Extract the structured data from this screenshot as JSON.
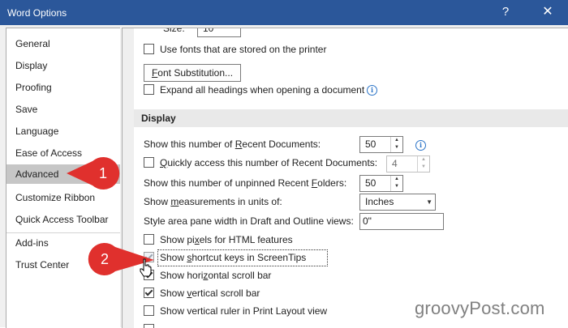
{
  "window": {
    "title": "Word Options",
    "help_label": "?",
    "close_label": "✕"
  },
  "nav": {
    "items": [
      {
        "label": "General"
      },
      {
        "label": "Display"
      },
      {
        "label": "Proofing"
      },
      {
        "label": "Save"
      },
      {
        "label": "Language"
      },
      {
        "label": "Ease of Access"
      },
      {
        "label": "Advanced",
        "selected": true
      },
      {
        "label": "Customize Ribbon"
      },
      {
        "label": "Quick Access Toolbar"
      },
      {
        "label": "Add-ins"
      },
      {
        "label": "Trust Center"
      }
    ]
  },
  "main": {
    "top": {
      "size_partial": "Size:",
      "size_value": "10",
      "use_printer_fonts": {
        "label": "Use fonts that are stored on the printer",
        "checked": false
      },
      "font_substitution_prefix": "F",
      "font_substitution_rest": "ont Substitution...",
      "expand_headings": {
        "label": "Expand all headings when opening a document",
        "checked": false
      }
    },
    "display": {
      "heading": "Display",
      "recent_docs_pre": "Show this number of ",
      "recent_docs_key": "R",
      "recent_docs_post": "ecent Documents:",
      "recent_docs_value": "50",
      "quick_access_key": "Q",
      "quick_access_post": "uickly access this number of Recent Documents:",
      "quick_access_value": "4",
      "quick_access_checked": false,
      "recent_folders_pre": "Show this number of unpinned Recent ",
      "recent_folders_key": "F",
      "recent_folders_post": "olders:",
      "recent_folders_value": "50",
      "measurement_pre": "Show ",
      "measurement_key": "m",
      "measurement_post": "easurements in units of:",
      "measurement_value": "Inches",
      "style_area_label": "Style area pane width in Draft and Outline views:",
      "style_area_value": "0\"",
      "pixels_html_pre": "Show pi",
      "pixels_html_key": "x",
      "pixels_html_post": "els for HTML features",
      "pixels_html_checked": false,
      "shortcut_pre": "Show ",
      "shortcut_key": "s",
      "shortcut_post": "hortcut keys in ScreenTips",
      "shortcut_checked": true,
      "horizontal_pre": "Show hori",
      "horizontal_key": "z",
      "horizontal_post": "ontal scroll bar",
      "horizontal_checked": true,
      "vertical_pre": "Show ",
      "vertical_key": "v",
      "vertical_post": "ertical scroll bar",
      "vertical_checked": true,
      "ruler_label": "Show vertical ruler in Print Layout view",
      "ruler_checked": false
    }
  },
  "callouts": [
    {
      "number": "1"
    },
    {
      "number": "2"
    }
  ],
  "watermark": "groovyPost.com",
  "colors": {
    "titlebar": "#2b579a",
    "callout": "#e0302d",
    "selected_nav": "#c6c6c6"
  },
  "icons": {
    "info": "info-icon",
    "cursor": "mouse-pointer-icon"
  }
}
